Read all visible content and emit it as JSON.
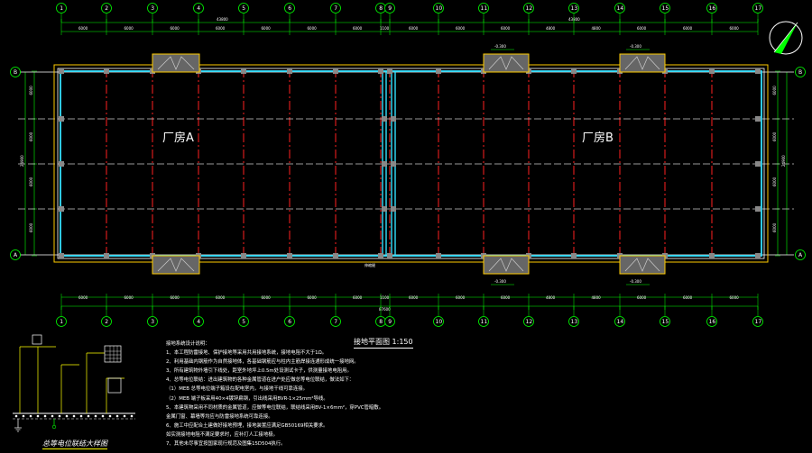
{
  "rooms": [
    "厂房A",
    "厂房B"
  ],
  "plan_title": "接地平面图 1:150",
  "detail_title": "总等电位联结大样图",
  "grid_numbers": [
    "1",
    "2",
    "3",
    "4",
    "5",
    "6",
    "7",
    "8",
    "9",
    "10",
    "11",
    "12",
    "13",
    "14",
    "15",
    "16",
    "17"
  ],
  "grid_letters": [
    "B",
    "A"
  ],
  "dims": {
    "total_left": "43800",
    "total_right": "43800",
    "total_overall": "87600",
    "bay": "6000",
    "bay_special": "4800",
    "joint": "1100",
    "depth_total": "24900",
    "depth_seg": "6000"
  },
  "elevations": {
    "minus": "-0.300"
  },
  "joint_label": "伸缩缝",
  "notes": [
    "接地系统设计说明：",
    "1、本工程防雷接地、保护接地等采用共用接地系统，接地电阻不大于1Ω。",
    "2、利用基础内钢筋作为自然接地体，各基础钢筋应与柱内主筋焊接连通形成统一接地网。",
    "3、所有建筑物外墙引下线处，距室外地坪上0.5m处设测试卡子，供测量接地电阻用。",
    "4、总等电位联结：进出建筑物的各种金属管道在进户处应做总等电位联结，做法如下：",
    "（1）MEB 总等电位端子箱设在配电室内，与接地干线可靠连接。",
    "（2）MEB 端子板采用40×4镀锌扁钢，引出线采用BVR-1×25mm²导线。",
    "5、本建筑物采用不同材质的金属管道，应做等电位联结，联结线采用BV-1×6mm²，穿PVC管暗敷。",
    "   金属门窗、幕墙等均应与防雷接地系统可靠连接。",
    "6、施工中应配合土建做好接地预埋，接地装置应满足GB50169相关要求。",
    "   如实测接地电阻不满足要求时，应补打人工接地极。",
    "7、其他未尽事宜按国家现行规范及图集15D504执行。"
  ]
}
